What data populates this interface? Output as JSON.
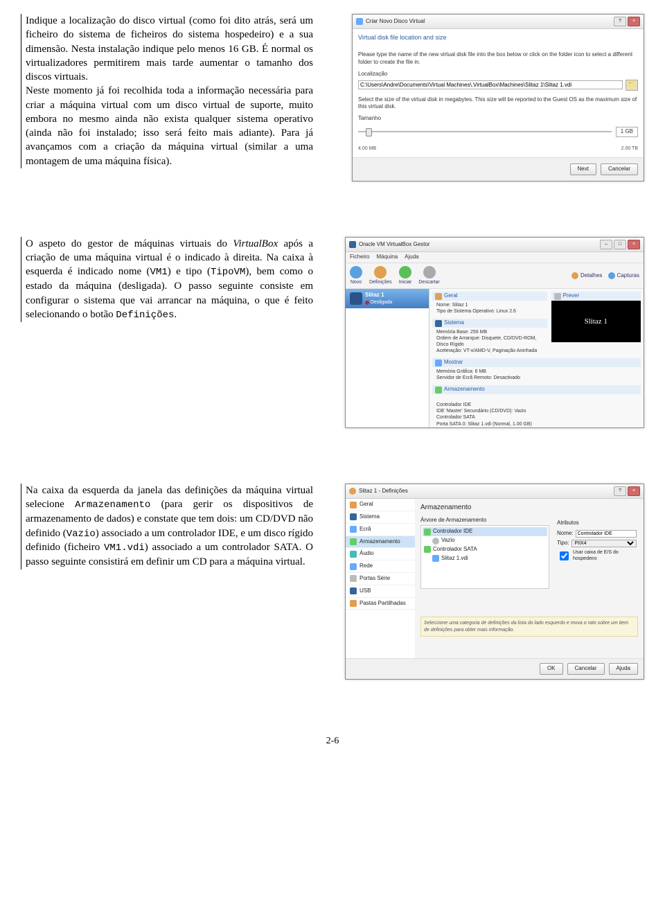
{
  "page_number": "2-6",
  "para1": "Indique a localização do disco virtual (como foi dito atrás, será um ficheiro do sistema de ficheiros do sistema hospedeiro) e a sua dimensão. Nesta instalação indique pelo menos 16 GB. É normal os virtualizadores permitirem mais tarde aumentar o tamanho dos discos virtuais.",
  "para1b": "Neste momento já foi recolhida toda a informação necessária para criar a máquina virtual com um disco virtual de suporte, muito embora no mesmo ainda não exista qualquer sistema operativo (ainda não foi instalado; isso será feito mais adiante). Para já avançamos com a criação da máquina virtual (similar a uma montagem de uma máquina física).",
  "para2_a": "O aspeto do gestor de máquinas virtuais do ",
  "para2_vb": "VirtualBox",
  "para2_b": " após a criação de uma máquina virtual é o indicado à direita. Na caixa à esquerda é indicado nome (",
  "para2_c": ") e tipo (",
  "para2_d": "), bem como o estado da máquina (desligada). O passo seguinte consiste em configurar o sistema que vai arrancar na máquina, o que é feito selecionando o botão ",
  "para2_end": ".",
  "mono_vm1": "VM1",
  "mono_tipovm": "TipoVM",
  "mono_def": "Definições",
  "para3_a": "Na caixa da esquerda da janela das definições da máquina virtual selecione ",
  "mono_arm": "Armazenamento",
  "para3_b": " (para gerir os dispositivos de armazenamento de dados) e constate que tem dois: um CD/DVD não definido (",
  "mono_vazio": "Vazio",
  "para3_c": ") associado a um controlador IDE, e um disco rígido definido (ficheiro ",
  "mono_vm1vdi": "VM1.vdi",
  "para3_d": ") associado a um controlador SATA. O passo seguinte consistirá em definir um CD para a máquina virtual.",
  "fig1": {
    "title": "Criar Novo Disco Virtual",
    "subtitle": "Virtual disk file location and size",
    "desc1": "Please type the name of the new virtual disk file into the box below or click on the folder icon to select a different folder to create the file in.",
    "loc_label": "Localização",
    "path": "C:\\Users\\Andre\\Documents\\Virtual Machines\\.VirtualBox\\Machines\\Slitaz 1\\Slitaz 1.vdi",
    "desc2": "Select the size of the virtual disk in megabytes. This size will be reported to the Guest OS as the maximum size of this virtual disk.",
    "size_label": "Tamanho",
    "min": "4.00 MB",
    "max": "2.00 TB",
    "value": "1 GB",
    "btn_next": "Next",
    "btn_cancel": "Cancelar"
  },
  "fig2": {
    "title": "Oracle VM VirtualBox Gestor",
    "menu": [
      "Ficheiro",
      "Máquina",
      "Ajuda"
    ],
    "tools": [
      "Novo",
      "Definições",
      "Iniciar",
      "Descartar"
    ],
    "detalhes": "Detalhes",
    "capturas": "Capturas",
    "vm_name": "Slitaz 1",
    "vm_state": "Desligada",
    "geral": "Geral",
    "nome_l": "Nome:",
    "nome_v": "Slitaz 1",
    "tipo_l": "Tipo de Sistema Operativo:",
    "tipo_v": "Linux 2.6",
    "sistema": "Sistema",
    "mem_l": "Memória Base:",
    "mem_v": "256 MB",
    "ord_l": "Ordem de Arranque:",
    "ord_v": "Disquete, CD/DVD-ROM, Disco Rígido",
    "ace_l": "Aceleração:",
    "ace_v": "VT-x/AMD-V, Paginação Aninhada",
    "mostrar": "Mostrar",
    "mg_l": "Memória Gráfica:",
    "mg_v": "6 MB",
    "se_l": "Servidor de Ecrã Remoto:",
    "se_v": "Desactivado",
    "arm": "Armazenamento",
    "arm_lines": "Controlador IDE\nIDE 'Master' Secundário (CD/DVD): Vazio\nControlador SATA\nPorta SATA 0:",
    "arm_disk": "Slitaz 1.vdi (Normal, 1.00 GB)",
    "prever": "Prever",
    "preview_text": "Slitaz 1"
  },
  "fig3": {
    "title": "Slitaz 1 - Definições",
    "side": [
      "Geral",
      "Sistema",
      "Ecrã",
      "Armazenamento",
      "Áudio",
      "Rede",
      "Portas Série",
      "USB",
      "Pastas Partilhadas"
    ],
    "side_sel": 3,
    "sec_title": "Armazenamento",
    "tree_title": "Árvore de Armazenamento",
    "tree": {
      "ide": "Controlador IDE",
      "vazio": "Vazio",
      "sata": "Controlador SATA",
      "disk": "Slitaz 1.vdi"
    },
    "attrs_title": "Atributos",
    "nome_l": "Nome:",
    "nome_v": "Controlador IDE",
    "tipo_l": "Tipo:",
    "tipo_v": "PIIX4",
    "host_cache": "Usar caixa de E/S do hospedeiro",
    "help": "Seleccione uma categoria de definições da lista do lado esquerdo e mova o rato sobre um item de definições para obter mais informação.",
    "btn_ok": "OK",
    "btn_cancel": "Cancelar",
    "btn_help": "Ajuda"
  }
}
